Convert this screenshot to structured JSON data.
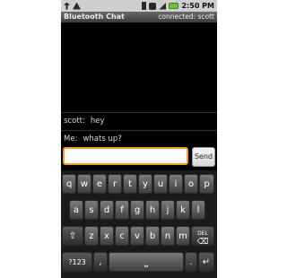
{
  "status_bar": {
    "icons_left": [
      "usb-icon",
      "warning-icon"
    ],
    "icons_right": [
      "bluetooth-icon",
      "sync-icon",
      "signal-icon",
      "battery-icon"
    ],
    "time": "2:50 PM"
  },
  "app": {
    "title": "Bluetooth Chat",
    "connection": "connected: scott"
  },
  "messages": [
    {
      "sender": "scott:",
      "text": "hey"
    },
    {
      "sender": "Me:",
      "text": "whats up?"
    }
  ],
  "composer": {
    "value": "",
    "send_label": "Send"
  },
  "keyboard": {
    "row1": [
      "q",
      "w",
      "e",
      "r",
      "t",
      "y",
      "u",
      "i",
      "o",
      "p"
    ],
    "row2": [
      "a",
      "s",
      "d",
      "f",
      "g",
      "h",
      "j",
      "k",
      "l"
    ],
    "row3": [
      "z",
      "x",
      "c",
      "v",
      "b",
      "n",
      "m"
    ],
    "shift_glyph": "⇧",
    "delete_label": "DEL",
    "delete_glyph": "⌫",
    "symbols_label": "?123",
    "comma": ",",
    "space_glyph": "⎵",
    "period": ".",
    "enter_glyph": "↵"
  }
}
